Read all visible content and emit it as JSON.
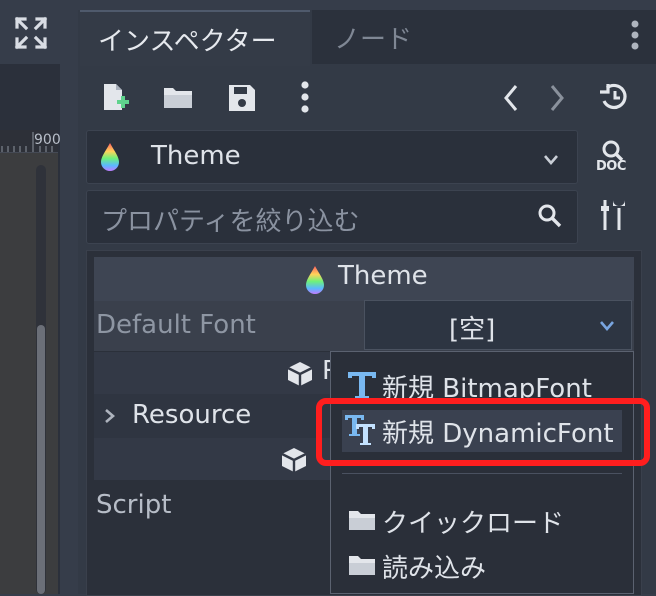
{
  "tabs": [
    {
      "label": "インスペクター",
      "active": true
    },
    {
      "label": "ノード",
      "active": false
    }
  ],
  "toolbar": {
    "icons": [
      "new-resource-icon",
      "open-folder-icon",
      "save-icon",
      "more-vertical-icon",
      "back-icon",
      "forward-icon",
      "history-icon"
    ]
  },
  "resource_select": {
    "label": "Theme",
    "icon": "theme-droplet-icon"
  },
  "doc_button": {
    "label": "DOC"
  },
  "filter": {
    "placeholder": "プロパティを絞り込む"
  },
  "ruler": {
    "label": "900"
  },
  "inspector": {
    "header": "Theme",
    "default_font": {
      "label": "Default Font",
      "value": "[空]"
    },
    "sub_text_1": "R",
    "resource": {
      "label": "Resource"
    },
    "script": {
      "label": "Script"
    }
  },
  "dropdown": {
    "items": [
      {
        "label": "新規 BitmapFont",
        "icon": "bitmap-font-icon",
        "highlighted": false
      },
      {
        "label": "新規 DynamicFont",
        "icon": "dynamic-font-icon",
        "highlighted": true
      },
      {
        "label": "クイックロード",
        "icon": "folder-icon",
        "highlighted": false
      },
      {
        "label": "読み込み",
        "icon": "folder-icon",
        "highlighted": false
      }
    ]
  },
  "colors": {
    "accent": "#79a5e0",
    "highlight_border": "#ff1e1e"
  }
}
